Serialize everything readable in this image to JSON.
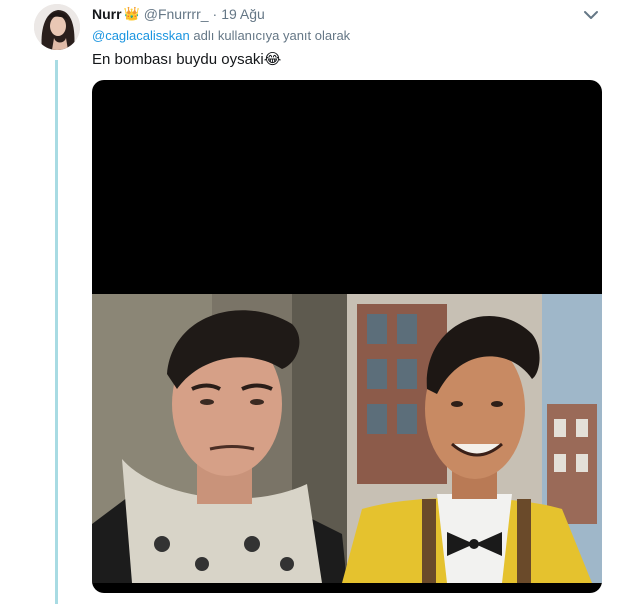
{
  "tweet": {
    "display_name": "Nurr",
    "handle": "@Fnurrrr_",
    "separator": "·",
    "timestamp": "19 Ağu",
    "reply_mention": "@caglacalisskan",
    "reply_suffix": " adlı kullanıcıya yanıt olarak",
    "text": "En bombası buydu oysaki",
    "text_emoji": "😂",
    "crown_badge": "👑",
    "icons": {
      "menu": "chevron-down-icon",
      "badge": "crown-icon"
    }
  },
  "colors": {
    "thread_line": "#a8dbe3",
    "mention": "#1b95e0",
    "secondary_text": "#657786",
    "primary_text": "#14171a"
  }
}
